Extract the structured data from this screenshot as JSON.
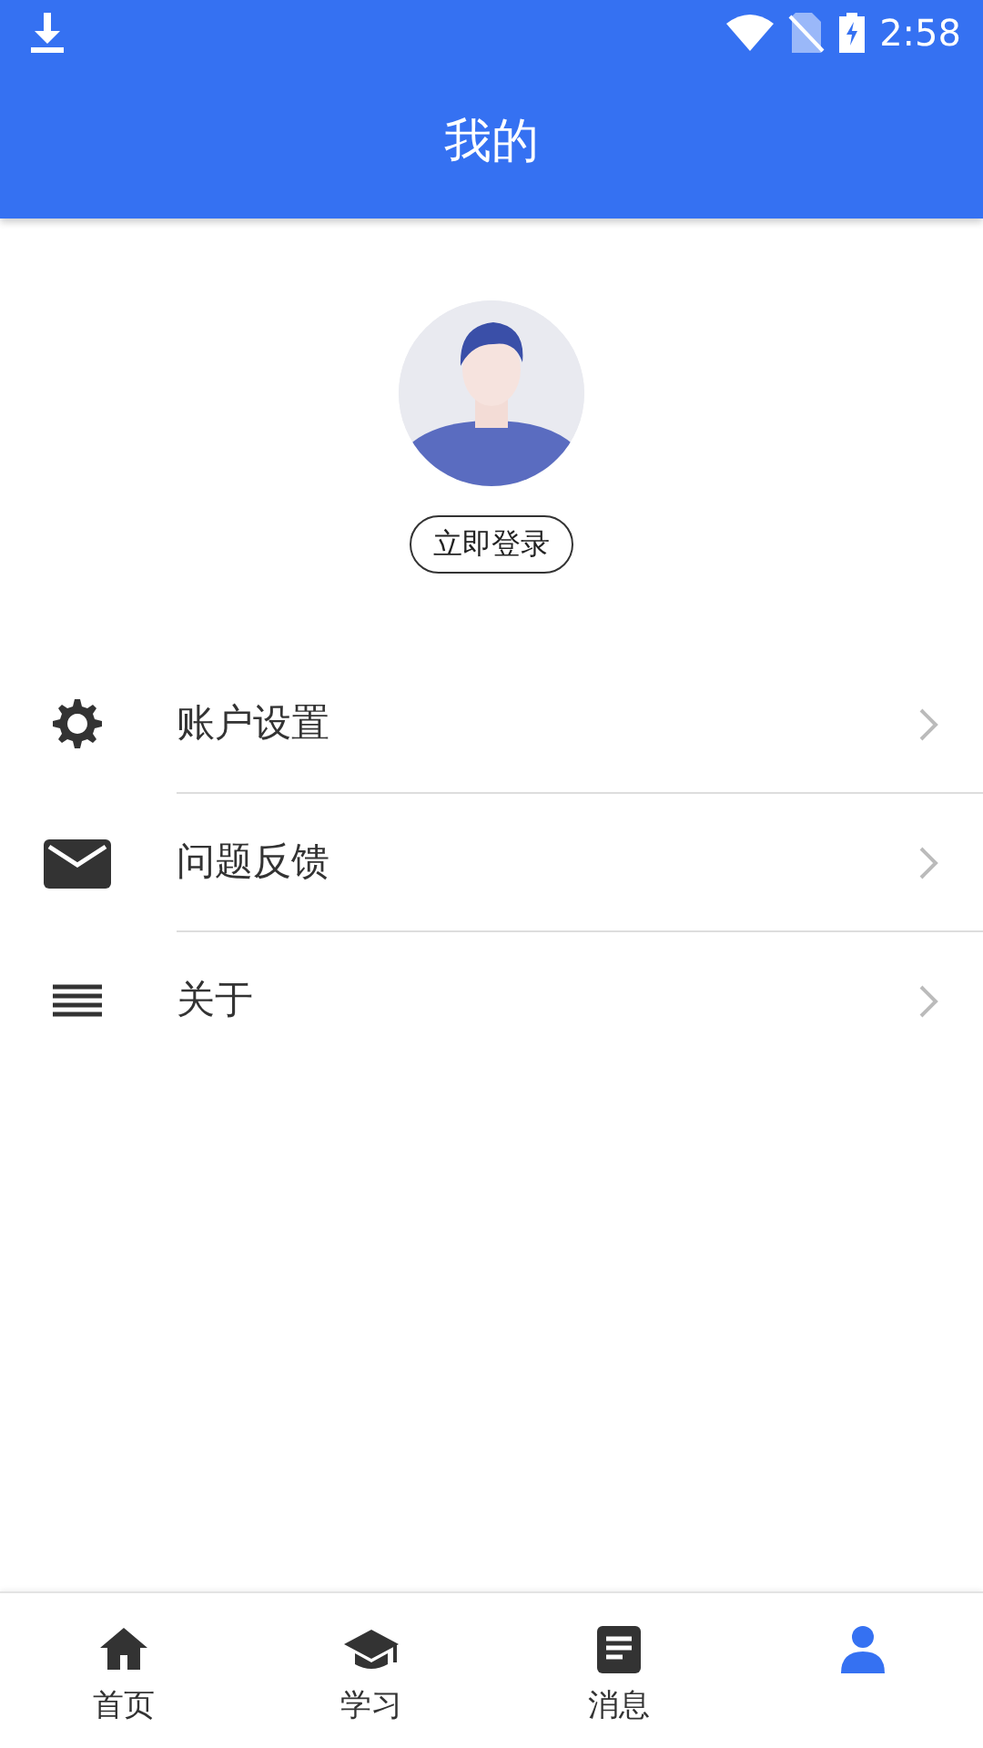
{
  "status_bar": {
    "time": "2:58"
  },
  "header": {
    "title": "我的"
  },
  "profile": {
    "login_button": "立即登录"
  },
  "menu": [
    {
      "kind": "settings",
      "label": "账户设置"
    },
    {
      "kind": "mail",
      "label": "问题反馈"
    },
    {
      "kind": "list",
      "label": "关于"
    }
  ],
  "bottom_nav": [
    {
      "kind": "home",
      "label": "首页",
      "selected": false
    },
    {
      "kind": "study",
      "label": "学习",
      "selected": false
    },
    {
      "kind": "news",
      "label": "消息",
      "selected": false
    },
    {
      "kind": "me",
      "selected": true
    }
  ]
}
